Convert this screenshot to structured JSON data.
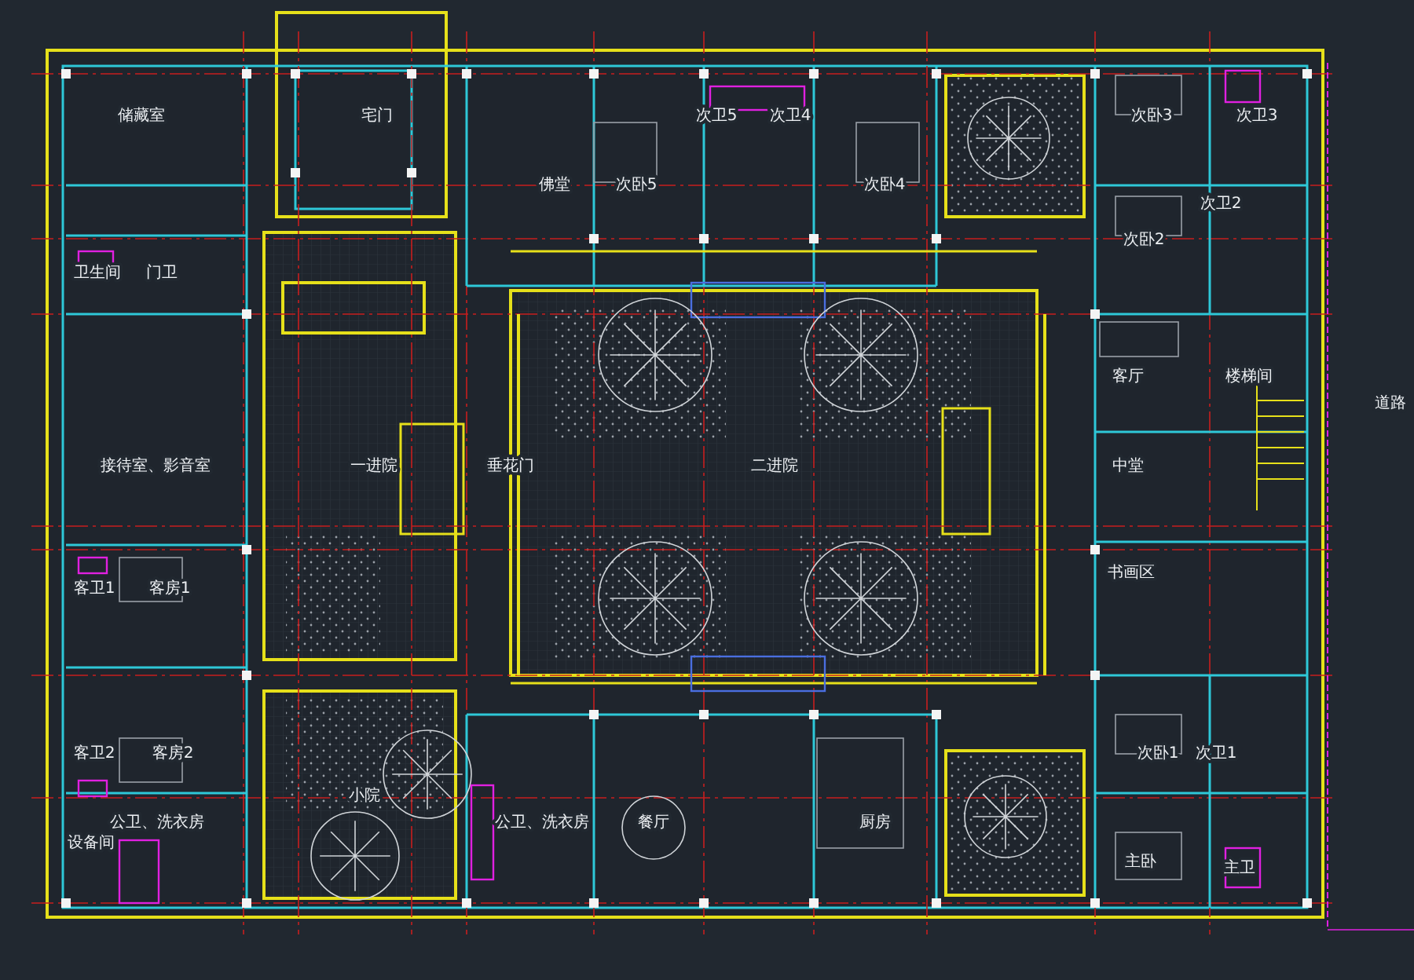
{
  "plan": {
    "rooms": [
      {
        "label": "储藏室"
      },
      {
        "label": "宅门"
      },
      {
        "label": "次卫5"
      },
      {
        "label": "次卫4"
      },
      {
        "label": "次卧3"
      },
      {
        "label": "次卫3"
      },
      {
        "label": "佛堂"
      },
      {
        "label": "次卧5"
      },
      {
        "label": "次卧4"
      },
      {
        "label": "次卫2"
      },
      {
        "label": "次卧2"
      },
      {
        "label": "卫生间"
      },
      {
        "label": "门卫"
      },
      {
        "label": "客厅"
      },
      {
        "label": "楼梯间"
      },
      {
        "label": "道路"
      },
      {
        "label": "接待室、影音室"
      },
      {
        "label": "一进院"
      },
      {
        "label": "垂花门"
      },
      {
        "label": "二进院"
      },
      {
        "label": "中堂"
      },
      {
        "label": "书画区"
      },
      {
        "label": "客卫1"
      },
      {
        "label": "客房1"
      },
      {
        "label": "客卫2"
      },
      {
        "label": "客房2"
      },
      {
        "label": "次卧1"
      },
      {
        "label": "次卫1"
      },
      {
        "label": "小院"
      },
      {
        "label": "公卫、洗衣房"
      },
      {
        "label": "公卫、洗衣房"
      },
      {
        "label": "餐厅"
      },
      {
        "label": "厨房"
      },
      {
        "label": "设备间"
      },
      {
        "label": "主卧"
      },
      {
        "label": "主卫"
      }
    ]
  }
}
